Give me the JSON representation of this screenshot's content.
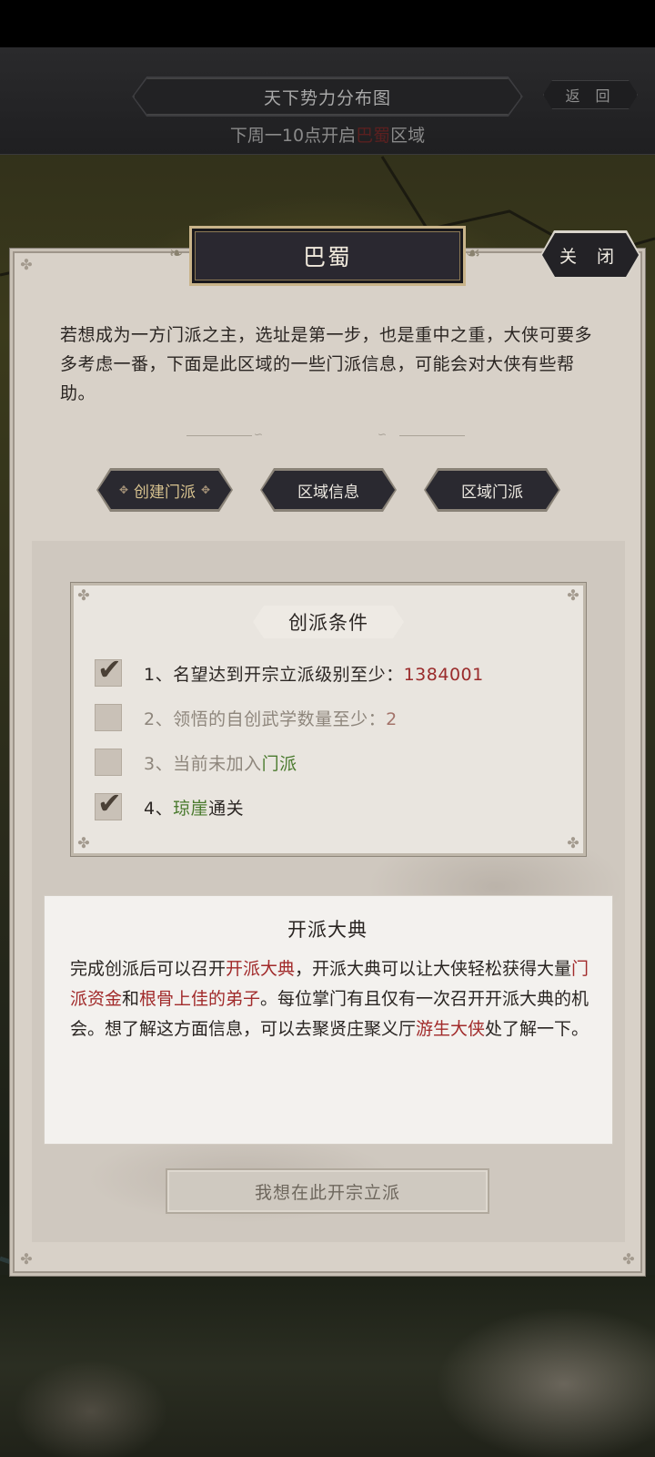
{
  "header": {
    "title": "天下势力分布图",
    "back_label": "返 回",
    "notice_prefix": "下周一10点开启",
    "notice_region": "巴蜀",
    "notice_suffix": "区域"
  },
  "panel": {
    "region_name": "巴蜀",
    "close_label": "关 闭",
    "intro": "若想成为一方门派之主，选址是第一步，也是重中之重，大侠可要多多考虑一番，下面是此区域的一些门派信息，可能会对大侠有些帮助。",
    "tabs": [
      {
        "label": "创建门派",
        "active": true
      },
      {
        "label": "区域信息",
        "active": false
      },
      {
        "label": "区域门派",
        "active": false
      }
    ]
  },
  "conditions": {
    "title": "创派条件",
    "items": [
      {
        "prefix": "1、名望达到开宗立派级别至少：",
        "value": "1384001",
        "checked": true
      },
      {
        "prefix": "2、领悟的自创武学数量至少：",
        "value": "2",
        "checked": false
      },
      {
        "prefix": "3、当前未加入",
        "value": "门派",
        "checked": false
      },
      {
        "prefix": "4、",
        "value": "琼崖",
        "suffix": "通关",
        "checked": true
      }
    ]
  },
  "ceremony": {
    "title": "开派大典",
    "p1": "完成创派后可以召开",
    "h1": "开派大典",
    "p2": "，开派大典可以让大侠轻松获得大量",
    "h2": "门派资金",
    "p3": "和",
    "h3": "根骨上佳的弟子",
    "p4": "。每位掌门有且仅有一次召开开派大典的机会。想了解这方面信息，可以去聚贤庄聚义厅",
    "h4": "游生大侠",
    "p5": "处了解一下。"
  },
  "found_button_label": "我想在此开宗立派",
  "colors": {
    "highlight_red": "#a12a2a",
    "highlight_green": "#4a7a2e",
    "panel_bg": "#d8d1c8"
  }
}
